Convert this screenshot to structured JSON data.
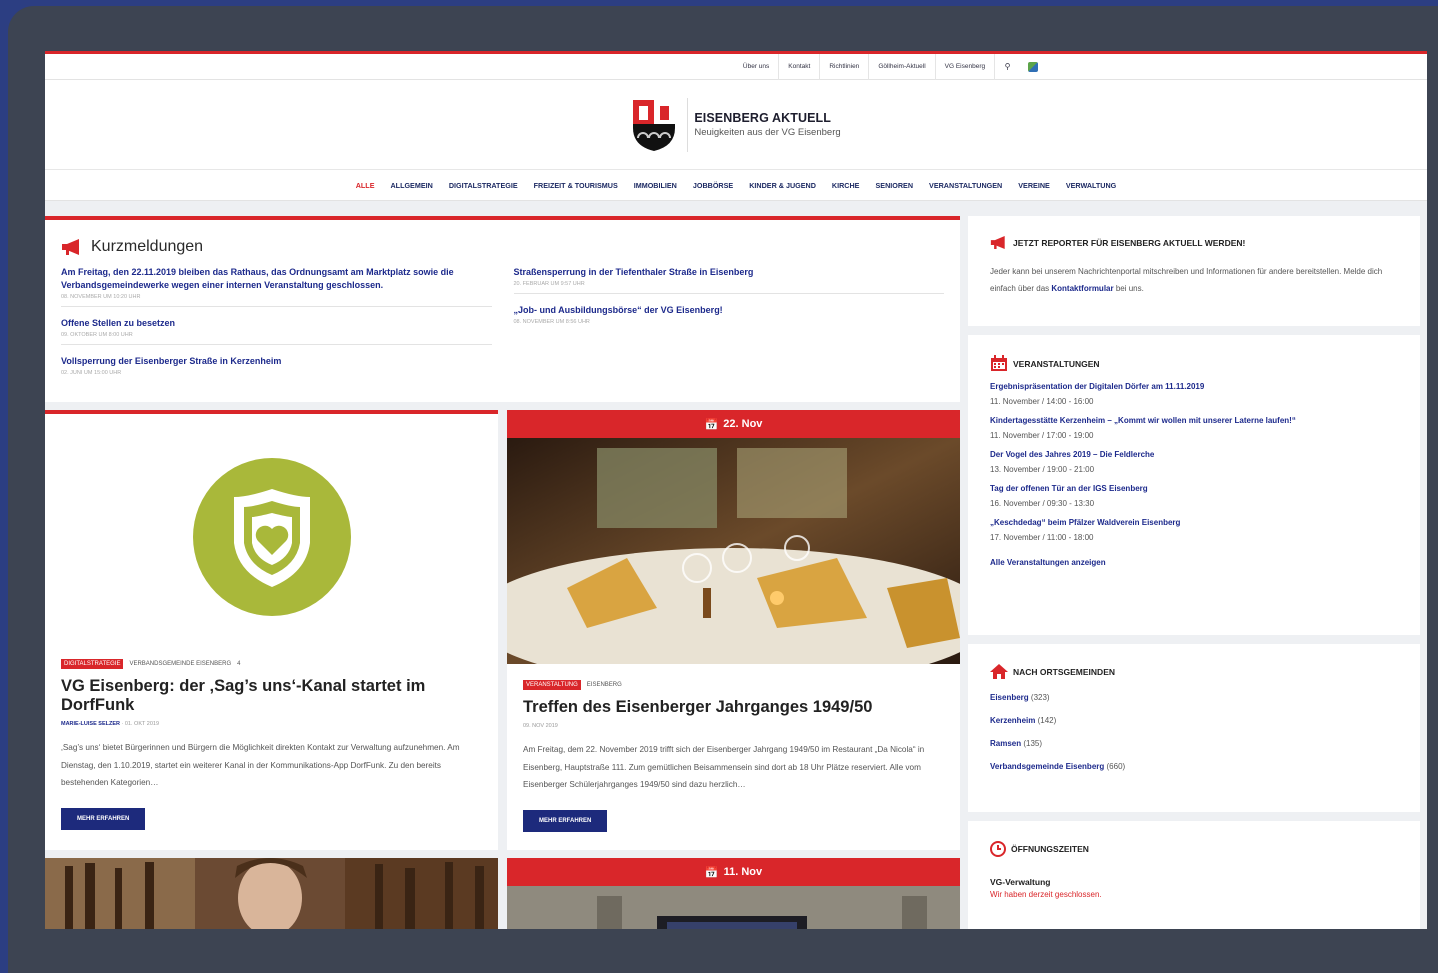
{
  "topbar": {
    "links": [
      "Über uns",
      "Kontakt",
      "Richtlinien",
      "Göllheim-Aktuell",
      "VG Eisenberg"
    ]
  },
  "brand": {
    "title": "EISENBERG AKTUELL",
    "subtitle": "Neuigkeiten aus der VG Eisenberg"
  },
  "nav": [
    "ALLE",
    "ALLGEMEIN",
    "DIGITALSTRATEGIE",
    "FREIZEIT & TOURISMUS",
    "IMMOBILIEN",
    "JOBBÖRSE",
    "KINDER & JUGEND",
    "KIRCHE",
    "SENIOREN",
    "VERANSTALTUNGEN",
    "VEREINE",
    "VERWALTUNG"
  ],
  "kurz": {
    "title": "Kurzmeldungen",
    "left": [
      {
        "h": "Am Freitag, den 22.11.2019 bleiben das Rathaus, das Ordnungsamt am Marktplatz sowie die Verbandsgemeindewerke wegen einer internen Veranstaltung geschlossen.",
        "d": "08. NOVEMBER UM 10:20 UHR"
      },
      {
        "h": "Offene Stellen zu besetzen",
        "d": "09. OKTOBER UM 8:00 UHR"
      },
      {
        "h": "Vollsperrung der Eisenberger Straße in Kerzenheim",
        "d": "02. JUNI UM 15:00 UHR"
      }
    ],
    "right": [
      {
        "h": "Straßensperrung in der Tiefenthaler Straße in Eisenberg",
        "d": "20. FEBRUAR UM 9:57 UHR"
      },
      {
        "h": "„Job- und Ausbildungsbörse“ der VG Eisenberg!",
        "d": "08. NOVEMBER UM 8:56 UHR"
      }
    ]
  },
  "post1": {
    "tag": "DIGITALSTRATEGIE",
    "cat": "VERBANDSGEMEINDE EISENBERG",
    "num": "4",
    "title": "VG Eisenberg: der ‚Sag’s uns‘-Kanal startet im DorfFunk",
    "author": "MARIE-LUISE SELZER",
    "date": "01. OKT 2019",
    "excerpt": "‚Sag’s uns‘ bietet Bürgerinnen und Bürgern die Möglichkeit direkten Kontakt zur Verwaltung aufzunehmen. Am Dienstag, den 1.10.2019, startet ein weiterer Kanal in der Kommunikations-App DorfFunk. Zu den bereits bestehenden Kategorien…",
    "button": "MEHR ERFAHREN"
  },
  "post2": {
    "datebar": "22. Nov",
    "tag": "VERANSTALTUNG",
    "cat": "EISENBERG",
    "title": "Treffen des Eisenberger Jahrganges 1949/50",
    "date": "09. NOV 2019",
    "excerpt": "Am Freitag, dem 22. November 2019 trifft sich der Eisenberger Jahrgang 1949/50 im Restaurant „Da Nicola“ in Eisenberg, Hauptstraße 111. Zum gemütlichen Beisammensein sind dort ab 18 Uhr Plätze reserviert. Alle vom Eisenberger Schülerjahrganges 1949/50 sind dazu herzlich…",
    "button": "MEHR ERFAHREN"
  },
  "post4": {
    "datebar": "11. Nov"
  },
  "reporter": {
    "title": "JETZT REPORTER FÜR EISENBERG AKTUELL WERDEN!",
    "text1": "Jeder kann bei unserem Nachrichtenportal mitschreiben und Informationen für andere bereitstellen. Melde dich einfach über das ",
    "link": "Kontaktformular",
    "text2": " bei uns."
  },
  "events": {
    "title": "VERANSTALTUNGEN",
    "items": [
      {
        "h": "Ergebnispräsentation der Digitalen Dörfer am 11.11.2019",
        "d": "11. November / 14:00 - 16:00"
      },
      {
        "h": "Kindertagesstätte Kerzenheim – „Kommt wir wollen mit unserer Laterne laufen!“",
        "d": "11. November / 17:00 - 19:00"
      },
      {
        "h": "Der Vogel des Jahres 2019 – Die Feldlerche",
        "d": "13. November / 19:00 - 21:00"
      },
      {
        "h": "Tag der offenen Tür an der IGS Eisenberg",
        "d": "16. November / 09:30 - 13:30"
      },
      {
        "h": "„Keschdedag“ beim Pfälzer Waldverein Eisenberg",
        "d": "17. November / 11:00 - 18:00"
      }
    ],
    "all": "Alle Veranstaltungen anzeigen"
  },
  "orte": {
    "title": "NACH ORTSGEMEINDEN",
    "items": [
      {
        "name": "Eisenberg",
        "count": "(323)"
      },
      {
        "name": "Kerzenheim",
        "count": "(142)"
      },
      {
        "name": "Ramsen",
        "count": "(135)"
      },
      {
        "name": "Verbandsgemeinde Eisenberg",
        "count": "(660)"
      }
    ]
  },
  "hours": {
    "title": "ÖFFNUNGSZEITEN",
    "name": "VG-Verwaltung",
    "status": "Wir haben derzeit geschlossen."
  },
  "colors": {
    "accent": "#d9262a",
    "navy": "#1d2a7c",
    "olive": "#a9b83a"
  }
}
